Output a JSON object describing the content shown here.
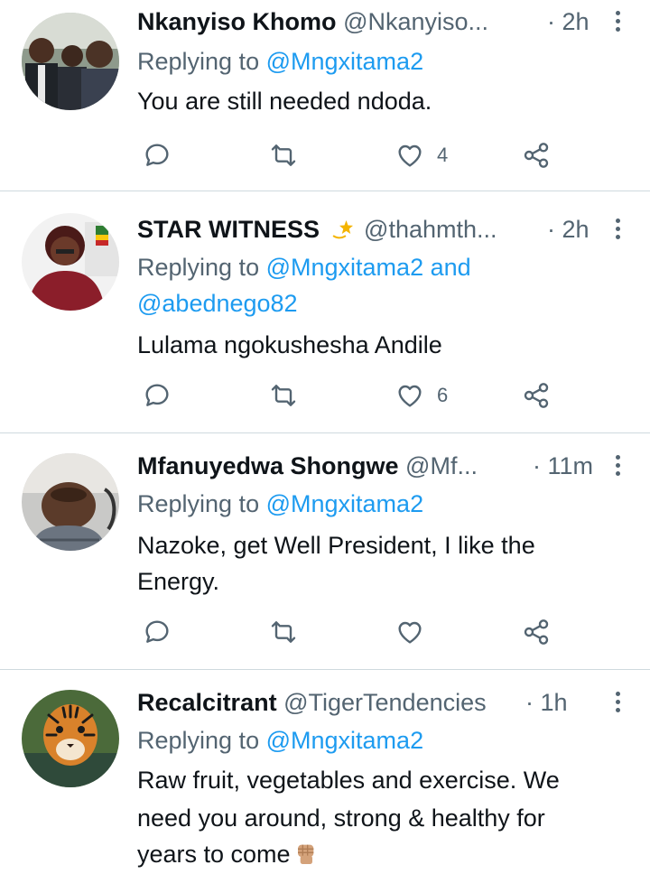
{
  "colors": {
    "name": "#0f1419",
    "secondary": "#536471",
    "mention": "#1d9bf0",
    "divider": "#cfd9de"
  },
  "tweets": [
    {
      "name": "Nkanyiso Khomo",
      "handle": "@Nkanyiso...",
      "time": "· 2h",
      "replying_prefix": "Replying to",
      "mentions": [
        "@Mngxitama2"
      ],
      "body": [
        "You are still needed ndoda."
      ],
      "likes": "4",
      "avatar": "group-photo-avatar"
    },
    {
      "name": "STAR WITNESS",
      "name_emoji": "dizzy-star-icon",
      "handle": "@thahmth...",
      "time": "· 2h",
      "replying_prefix": "Replying to",
      "mentions": [
        "@Mngxitama2",
        "@abednego82"
      ],
      "mention_joiner": "and",
      "body": [
        "Lulama ngokushesha Andile"
      ],
      "likes": "6",
      "avatar": "woman-portrait-avatar"
    },
    {
      "name": "Mfanuyedwa Shongwe",
      "handle": "@Mf...",
      "time": "· 11m",
      "replying_prefix": "Replying to",
      "mentions": [
        "@Mngxitama2"
      ],
      "body": [
        "Nazoke, get Well President, I like the",
        "Energy."
      ],
      "likes": "",
      "avatar": "man-selfie-avatar"
    },
    {
      "name": "Recalcitrant",
      "handle": "@TigerTendencies",
      "time": "· 1h",
      "replying_prefix": "Replying to",
      "mentions": [
        "@Mngxitama2"
      ],
      "body": [
        "Raw fruit, vegetables and exercise. We",
        "need you around, strong & healthy for",
        "years to come"
      ],
      "body_emoji": "raised-fist-icon",
      "likes": "",
      "avatar": "tiger-avatar"
    }
  ]
}
